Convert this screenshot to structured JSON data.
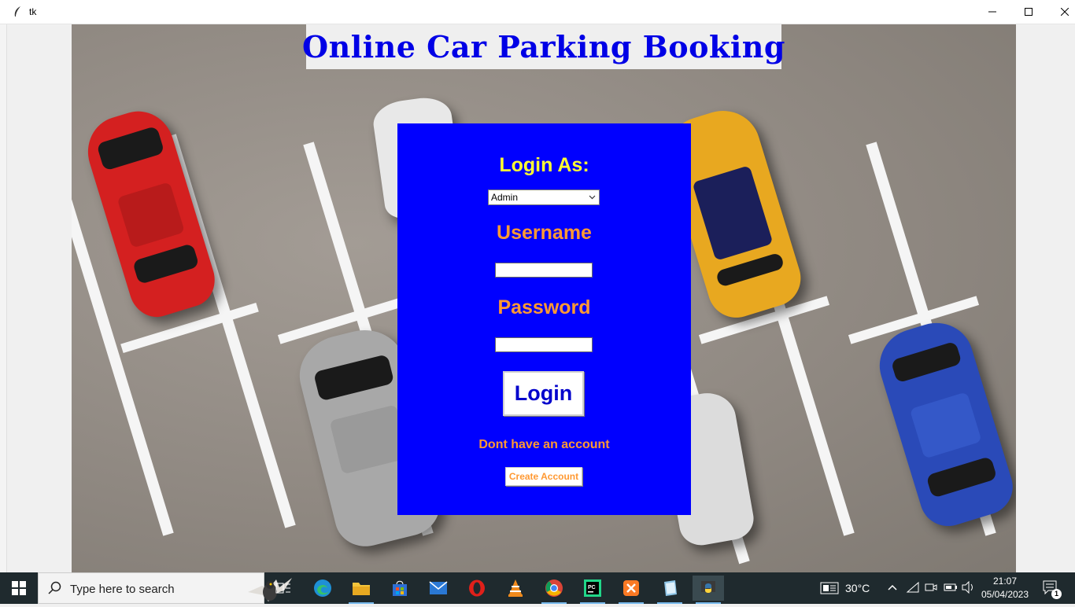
{
  "window": {
    "title": "tk"
  },
  "header": {
    "title": "Online Car Parking Booking"
  },
  "login": {
    "login_as_label": "Login As:",
    "role_selected": "Admin",
    "username_label": "Username",
    "username_value": "",
    "password_label": "Password",
    "password_value": "",
    "login_button": "Login",
    "no_account_text": "Dont have an account",
    "create_account_button": "Create Account"
  },
  "colors": {
    "panel_bg": "#0000ff",
    "title_text": "#0000e6",
    "login_as_text": "#ffff33",
    "field_label_text": "#ff9933"
  },
  "taskbar": {
    "search_placeholder": "Type here to search",
    "apps": [
      "task-view-icon",
      "edge-icon",
      "file-explorer-icon",
      "store-icon",
      "mail-icon",
      "opera-icon",
      "vlc-icon",
      "chrome-icon",
      "pycharm-icon",
      "xampp-icon",
      "notepad-icon",
      "python-icon"
    ],
    "weather": "30°C",
    "time": "21:07",
    "date": "05/04/2023",
    "notification_count": "1"
  }
}
